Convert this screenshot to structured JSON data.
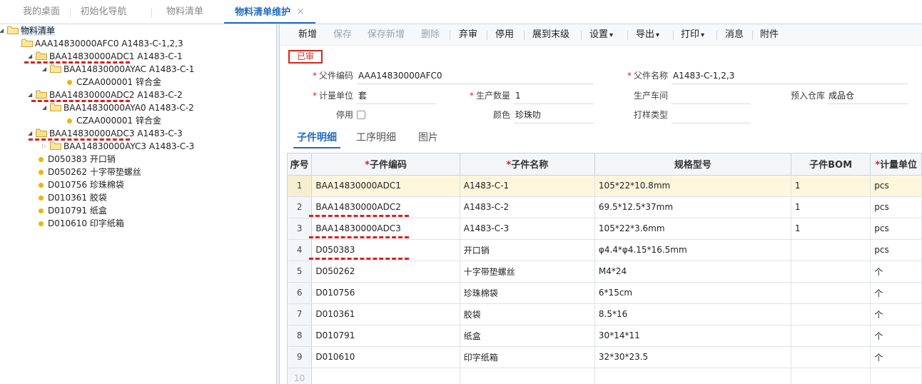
{
  "tabs": [
    {
      "label": "我的桌面"
    },
    {
      "label": "初始化导航"
    },
    {
      "label": "物料清单"
    },
    {
      "label": "物料清单维护",
      "close": "✕"
    }
  ],
  "tree": {
    "root": "物料清单",
    "level1": "AAA14830000AFC0 A1483-C-1,2,3",
    "level2": [
      {
        "label": "BAA14830000ADC1 A1483-C-1",
        "child": "BAA14830000AYAC A1483-C-1",
        "grandchild": "CZAA000001 锌合金"
      },
      {
        "label": "BAA14830000ADC2 A1483-C-2",
        "child": "BAA14830000AYA0 A1483-C-2",
        "grandchild": "CZAA000001 锌合金"
      },
      {
        "label": "BAA14830000ADC3 A1483-C-3",
        "child": "BAA14830000AYC3 A1483-C-3"
      }
    ],
    "leaves": [
      "D050383 开口销",
      "D050262 十字带垫螺丝",
      "D010756 珍珠棉袋",
      "D010361 胶袋",
      "D010791 纸盒",
      "D010610 印字纸箱"
    ]
  },
  "toolbar": {
    "add": "新增",
    "save": "保存",
    "save_new": "保存新增",
    "delete": "删除",
    "unaudit": "弃审",
    "disable": "停用",
    "expand": "展到末级",
    "settings": "设置",
    "export": "导出",
    "print": "打印",
    "message": "消息",
    "attachment": "附件",
    "caret": "▾"
  },
  "status": "已审",
  "form": {
    "parent_code_label": "父件编码",
    "parent_code": "AAA14830000AFC0",
    "parent_name_label": "父件名称",
    "parent_name": "A1483-C-1,2,3",
    "unit_label": "计量单位",
    "unit": "套",
    "qty_label": "生产数量",
    "qty": "1",
    "workshop_label": "生产车间",
    "workshop": "",
    "warehouse_label": "预入仓库",
    "warehouse": "成品仓",
    "disabled_label": "停用",
    "color_label": "颜色",
    "color": "珍珠叻",
    "sample_label": "打样类型",
    "sample": ""
  },
  "subtabs": [
    "子件明细",
    "工序明细",
    "图片"
  ],
  "grid": {
    "headers": [
      "序号",
      "子件编码",
      "子件名称",
      "规格型号",
      "子件BOM",
      "计量单位"
    ],
    "rows": [
      [
        "1",
        "BAA14830000ADC1",
        "A1483-C-1",
        "105*22*10.8mm",
        "1",
        "pcs"
      ],
      [
        "2",
        "BAA14830000ADC2",
        "A1483-C-2",
        "69.5*12.5*37mm",
        "1",
        "pcs"
      ],
      [
        "3",
        "BAA14830000ADC3",
        "A1483-C-3",
        "105*22*3.6mm",
        "1",
        "pcs"
      ],
      [
        "4",
        "D050383",
        "开口销",
        "φ4.4*φ4.15*16.5mm",
        "",
        "pcs"
      ],
      [
        "5",
        "D050262",
        "十字带垫螺丝",
        "M4*24",
        "",
        "个"
      ],
      [
        "6",
        "D010756",
        "珍珠棉袋",
        "6*15cm",
        "",
        "个"
      ],
      [
        "7",
        "D010361",
        "胶袋",
        "8.5*16",
        "",
        "个"
      ],
      [
        "8",
        "D010791",
        "纸盒",
        "30*14*11",
        "",
        "个"
      ],
      [
        "9",
        "D010610",
        "印字纸箱",
        "32*30*23.5",
        "",
        "个"
      ],
      [
        "10",
        "",
        "",
        "",
        "",
        ""
      ]
    ]
  }
}
